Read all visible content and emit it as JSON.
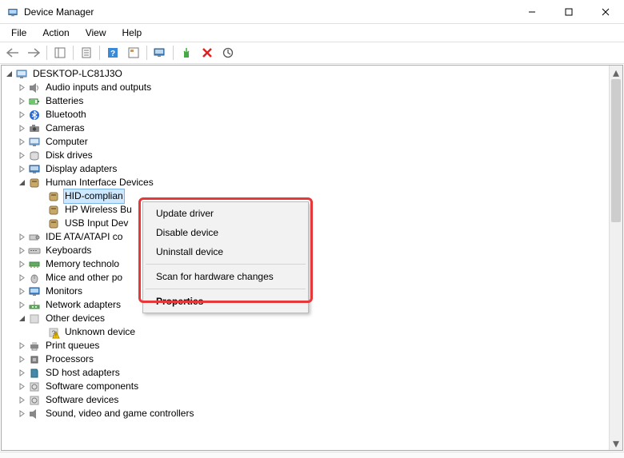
{
  "window": {
    "title": "Device Manager"
  },
  "menu": {
    "file": "File",
    "action": "Action",
    "view": "View",
    "help": "Help"
  },
  "tree": {
    "root": "DESKTOP-LC81J3O",
    "categories": [
      {
        "label": "Audio inputs and outputs",
        "expanded": false
      },
      {
        "label": "Batteries",
        "expanded": false
      },
      {
        "label": "Bluetooth",
        "expanded": false
      },
      {
        "label": "Cameras",
        "expanded": false
      },
      {
        "label": "Computer",
        "expanded": false
      },
      {
        "label": "Disk drives",
        "expanded": false
      },
      {
        "label": "Display adapters",
        "expanded": false
      },
      {
        "label": "Human Interface Devices",
        "expanded": true,
        "children": [
          {
            "label": "HID-complian",
            "selected": true
          },
          {
            "label": "HP Wireless Bu"
          },
          {
            "label": "USB Input Dev"
          }
        ]
      },
      {
        "label": "IDE ATA/ATAPI co",
        "expanded": false
      },
      {
        "label": "Keyboards",
        "expanded": false
      },
      {
        "label": "Memory technolo",
        "expanded": false
      },
      {
        "label": "Mice and other po",
        "expanded": false
      },
      {
        "label": "Monitors",
        "expanded": false
      },
      {
        "label": "Network adapters",
        "expanded": false
      },
      {
        "label": "Other devices",
        "expanded": true,
        "children": [
          {
            "label": "Unknown device",
            "warning": true
          }
        ]
      },
      {
        "label": "Print queues",
        "expanded": false
      },
      {
        "label": "Processors",
        "expanded": false
      },
      {
        "label": "SD host adapters",
        "expanded": false
      },
      {
        "label": "Software components",
        "expanded": false
      },
      {
        "label": "Software devices",
        "expanded": false
      },
      {
        "label": "Sound, video and game controllers",
        "expanded": false
      }
    ]
  },
  "context_menu": {
    "update_driver": "Update driver",
    "disable_device": "Disable device",
    "uninstall_device": "Uninstall device",
    "scan_hardware": "Scan for hardware changes",
    "properties": "Properties"
  }
}
